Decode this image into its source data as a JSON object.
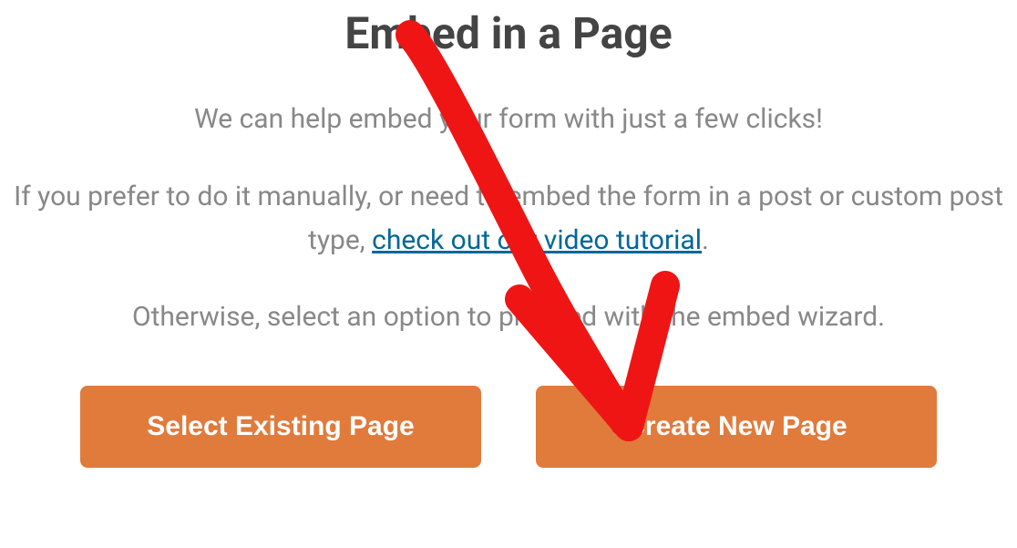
{
  "modal": {
    "title": "Embed in a Page",
    "subtitle": "We can help embed your form with just a few clicks!",
    "paragraph1_prefix": "If you prefer to do it manually, or need to embed the form in a post or custom post type, ",
    "link_text": "check out our video tutorial",
    "paragraph1_suffix": ".",
    "paragraph2": "Otherwise, select an option to proceed with the embed wizard.",
    "buttons": {
      "existing": "Select Existing Page",
      "new": "Create New Page"
    }
  },
  "annotation": {
    "arrow_color": "#ef1515",
    "target": "create-new-page-button"
  }
}
